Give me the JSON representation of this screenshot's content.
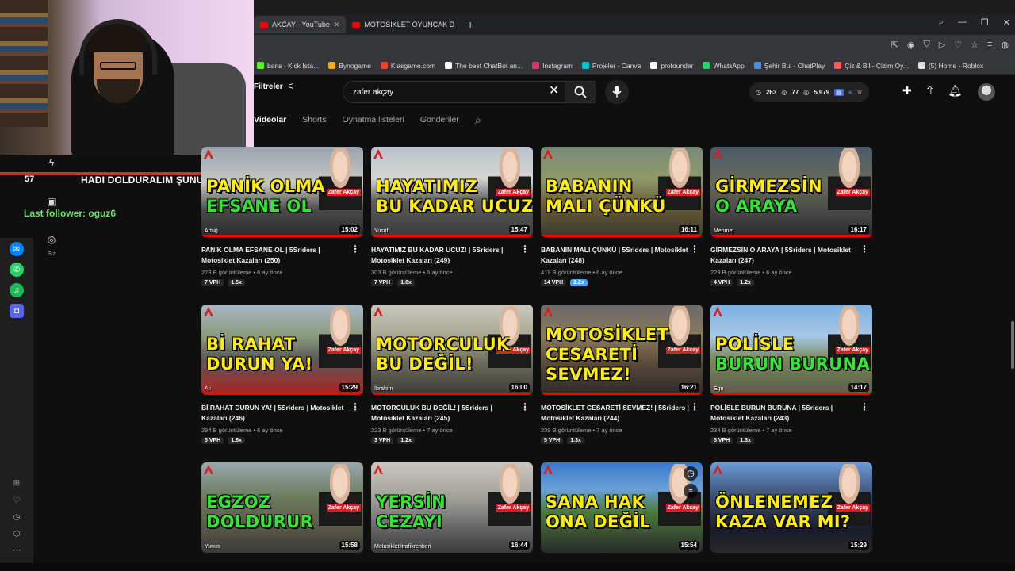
{
  "browser": {
    "tabs": [
      {
        "label": "AKCAY - YouTube"
      },
      {
        "label": "MOTOSİKLET OYUNCAK D"
      }
    ],
    "new_tab": "+",
    "bookmarks": [
      {
        "label": "bans - Kick İsta...",
        "color": "#53fc18"
      },
      {
        "label": "Bynogame",
        "color": "#f5a623"
      },
      {
        "label": "Klasgame.com",
        "color": "#e8412c"
      },
      {
        "label": "The best ChatBot an...",
        "color": "#ffffff"
      },
      {
        "label": "Instagram",
        "color": "#e1306c"
      },
      {
        "label": "Projeler - Canva",
        "color": "#00c4cc"
      },
      {
        "label": "profounder",
        "color": "#ffffff"
      },
      {
        "label": "WhatsApp",
        "color": "#25d366"
      },
      {
        "label": "Şehir Bul - ChatPlay",
        "color": "#4a90e2"
      },
      {
        "label": "Çiz & Bil - Çizim Oy...",
        "color": "#ff5a5a"
      },
      {
        "label": "(5) Home - Roblox",
        "color": "#dddddd"
      }
    ]
  },
  "stream_overlay": {
    "alert_number": "57",
    "alert_text": "HADI DOLDURALIM ŞUNU",
    "last_follower": "Last follower: oguz6",
    "nav_you_label": "Siz"
  },
  "header": {
    "filters_label": "Filtreler",
    "search_value": "zafer akçay",
    "stats": {
      "views_a": "263",
      "views_b": "77",
      "views_c": "5,979"
    }
  },
  "channel_tabs": [
    {
      "label": "Videolar",
      "active": true
    },
    {
      "label": "Shorts",
      "active": false
    },
    {
      "label": "Oynatma listeleri",
      "active": false
    },
    {
      "label": "Gönderiler",
      "active": false
    }
  ],
  "videos": [
    {
      "line1": "PANİK OLMA",
      "line2": "EFSANE OL",
      "c1": "yellow",
      "c2": "green",
      "rider": "Artuğ",
      "duration": "15:02",
      "title": "PANİK OLMA EFSANE OL | 5Sriders | Motosiklet Kazaları (250)",
      "meta": "278 B görüntüleme • 6 ay önce",
      "vph": "7 VPH",
      "ratio": "1.5x",
      "hot": false,
      "progress": 1.0,
      "bg": "linear-gradient(180deg,#9aa3ad 0%,#c8c8c4 40%,#4a4a4a 70%,#2a2a2a 100%)"
    },
    {
      "line1": "HAYATIMIZ",
      "line2": "BU KADAR UCUZ!",
      "c1": "yellow",
      "c2": "yellow",
      "rider": "Yusuf",
      "duration": "15:47",
      "title": "HAYATIMIZ BU KADAR UCUZ! | 5Sriders | Motosiklet Kazaları (249)",
      "meta": "303 B görüntüleme • 6 ay önce",
      "vph": "7 VPH",
      "ratio": "1.8x",
      "hot": false,
      "progress": 1.0,
      "bg": "linear-gradient(180deg,#b8c2cc 0%,#d6d6d2 35%,#5d5d5d 60%,#3a3a3a 100%)"
    },
    {
      "line1": "BABANIN",
      "line2": "MALI ÇÜNKÜ",
      "c1": "yellow",
      "c2": "yellow",
      "rider": "",
      "duration": "16:11",
      "title": "BABANIN MALI ÇÜNKÜ | 5Sriders | Motosiklet Kazaları (248)",
      "meta": "419 B görüntüleme • 6 ay önce",
      "vph": "14 VPH",
      "ratio": "2.2x",
      "hot": true,
      "progress": 1.0,
      "bg": "linear-gradient(180deg,#7a8a7a 0%,#8e9a6a 35%,#6a5a3a 65%,#3a3a2a 100%)"
    },
    {
      "line1": "GİRMEZSİN",
      "line2": "O ARAYA",
      "c1": "yellow",
      "c2": "green",
      "rider": "Mehmet",
      "duration": "16:17",
      "title": "GİRMEZSİN O ARAYA | 5Sriders | Motosiklet Kazaları (247)",
      "meta": "229 B görüntüleme • 6 ay önce",
      "vph": "4 VPH",
      "ratio": "1.2x",
      "hot": false,
      "progress": 1.0,
      "bg": "linear-gradient(180deg,#4a5a6a 0%,#6a6a5a 40%,#4a4a4a 70%,#2a2a2a 100%)"
    },
    {
      "line1": "Bİ RAHAT",
      "line2": "DURUN YA!",
      "c1": "yellow",
      "c2": "yellow",
      "rider": "Ali",
      "duration": "15:29",
      "title": "Bİ RAHAT DURUN YA! | 5Sriders | Motosiklet Kazaları (246)",
      "meta": "294 B görüntüleme • 6 ay önce",
      "vph": "5 VPH",
      "ratio": "1.6x",
      "hot": false,
      "progress": 1.0,
      "bg": "linear-gradient(180deg,#a8b8c8 0%,#8a9a7a 35%,#5a5a5a 60%,#b02020 100%)"
    },
    {
      "line1": "MOTORCULUK",
      "line2": "BU DEĞİL!",
      "c1": "yellow",
      "c2": "yellow",
      "rider": "İbrahim",
      "duration": "16:00",
      "title": "MOTORCULUK BU DEĞİL! | 5Sriders | Motosiklet Kazaları (245)",
      "meta": "223 B görüntüleme • 7 ay önce",
      "vph": "3 VPH",
      "ratio": "1.2x",
      "hot": false,
      "progress": 1.0,
      "bg": "linear-gradient(180deg,#c8c8c0 0%,#a8a890 35%,#6a6a5a 65%,#3a3a3a 100%)"
    },
    {
      "line1": "MOTOSİKLET",
      "line2": "CESARETİ",
      "c1": "yellow",
      "c2": "yellow",
      "line3": "SEVMEZ!",
      "rider": "",
      "duration": "16:21",
      "title": "MOTOSİKLET CESARETİ SEVMEZ! | 5Sriders | Motosiklet Kazaları (244)",
      "meta": "239 B görüntüleme • 7 ay önce",
      "vph": "5 VPH",
      "ratio": "1.3x",
      "hot": false,
      "progress": 1.0,
      "bg": "linear-gradient(180deg,#6a6a6a 0%,#8a7a5a 35%,#5a4a3a 65%,#2a2a2a 100%)"
    },
    {
      "line1": "POLİSLE",
      "line2": "BURUN BURUNA",
      "c1": "yellow",
      "c2": "green",
      "rider": "Ege",
      "duration": "14:17",
      "title": "POLİSLE BURUN BURUNA | 5Sriders | Motosiklet Kazaları (243)",
      "meta": "234 B görüntüleme • 7 ay önce",
      "vph": "5 VPH",
      "ratio": "1.3x",
      "hot": false,
      "progress": 1.0,
      "bg": "linear-gradient(180deg,#7ab0e0 0%,#a8c8e8 35%,#7a8a5a 60%,#5a5a4a 100%)"
    },
    {
      "line1": "EGZOZ",
      "line2": "DOLDURUR",
      "c1": "green",
      "c2": "green",
      "rider": "Yunus",
      "duration": "15:58",
      "title": "",
      "meta": "",
      "vph": "",
      "ratio": "",
      "hot": false,
      "progress": 0,
      "bg": "linear-gradient(180deg,#9aa8b0 0%,#6a7a5a 40%,#5a5a4a 70%,#3a3a3a 100%)"
    },
    {
      "line1": "YERSİN",
      "line2": "CEZAYI",
      "c1": "green",
      "c2": "green",
      "rider": "Motosikletlitrafikrehberi",
      "duration": "16:44",
      "title": "",
      "meta": "",
      "vph": "",
      "ratio": "",
      "hot": false,
      "progress": 0,
      "bg": "linear-gradient(180deg,#c8c8c0 0%,#a0a098 40%,#6a6a6a 70%,#3a3a3a 100%)"
    },
    {
      "line1": "SANA HAK",
      "line2": "ONA DEĞİL",
      "c1": "yellow",
      "c2": "yellow",
      "rider": "",
      "duration": "15:54",
      "title": "",
      "meta": "",
      "vph": "",
      "ratio": "",
      "hot": false,
      "progress": 0,
      "hover": true,
      "bg": "linear-gradient(180deg,#3a78c8 0%,#6aa0d8 30%,#4a7a3a 55%,#2a2a2a 100%)"
    },
    {
      "line1": "ÖNLENEMEZ",
      "line2": "KAZA VAR MI?",
      "c1": "yellow",
      "c2": "yellow",
      "rider": "",
      "duration": "15:29",
      "title": "",
      "meta": "",
      "vph": "",
      "ratio": "",
      "hot": false,
      "progress": 0,
      "bg": "linear-gradient(180deg,#6a9ad8 0%,#3a4a6a 40%,#1a1a2a 75%,#2a2a2a 100%)"
    }
  ],
  "host_label": "Zafer Akçay",
  "colors": {
    "accent": "#ff0000",
    "alert_line": "#c0392b",
    "follower": "#6ee36e",
    "thumb_yellow": "#ffee00",
    "thumb_green": "#33e633"
  }
}
